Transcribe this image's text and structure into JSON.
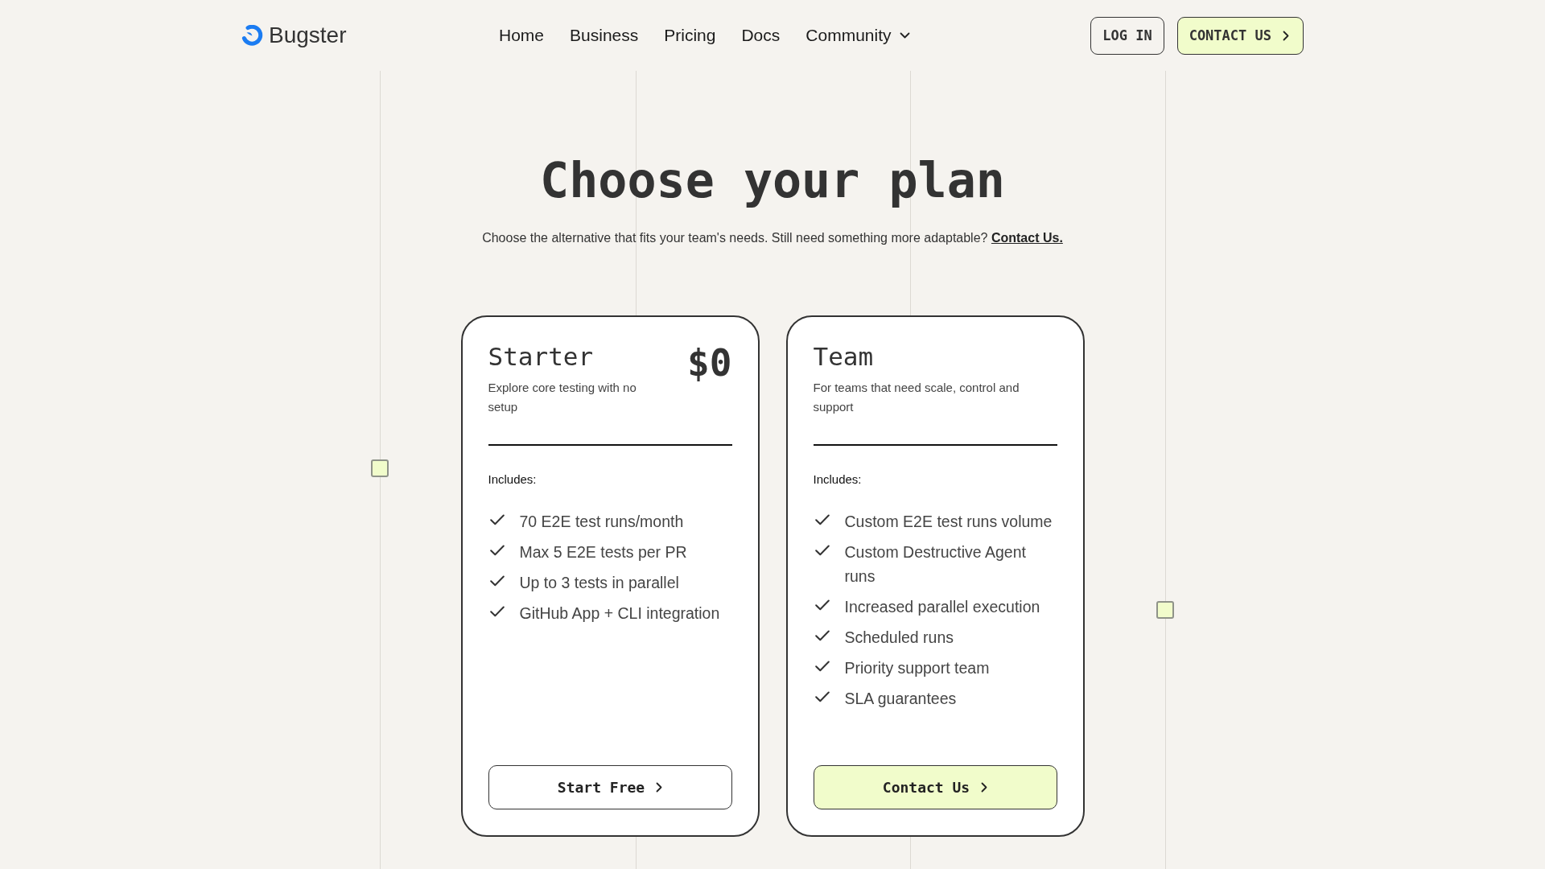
{
  "header": {
    "logo": {
      "text": "Bugster"
    },
    "nav": [
      {
        "label": "Home",
        "kind": "link"
      },
      {
        "label": "Business",
        "kind": "link"
      },
      {
        "label": "Pricing",
        "kind": "link"
      },
      {
        "label": "Docs",
        "kind": "link"
      },
      {
        "label": "Community",
        "kind": "menu"
      }
    ],
    "actions": [
      {
        "label": "LOG IN",
        "kind": "outline"
      },
      {
        "label": "CONTACT US",
        "kind": "primary"
      }
    ]
  },
  "hero": {
    "title": "Choose your plan",
    "subtitle": "Choose the alternative that fits your team's needs. Still need something more adaptable?",
    "link": "Contact Us."
  },
  "plans": [
    {
      "name": "Starter",
      "price": "$0",
      "description": "Explore core testing with no setup",
      "includes_label": "Includes:",
      "features": [
        "70 E2E test runs/month",
        "Max 5 E2E tests per PR",
        "Up to 3 tests in parallel",
        "GitHub App + CLI integration"
      ],
      "button": {
        "label": "Start Free",
        "kind": "outline"
      }
    },
    {
      "name": "Team",
      "description": "For teams that need scale, control and support",
      "includes_label": "Includes:",
      "features": [
        "Custom E2E test runs volume",
        "Custom Destructive Agent runs",
        "Increased parallel execution",
        "Scheduled runs",
        "Priority support team",
        "SLA guarantees"
      ],
      "button": {
        "label": "Contact Us",
        "kind": "primary"
      }
    }
  ]
}
